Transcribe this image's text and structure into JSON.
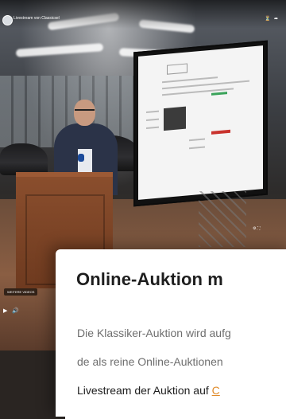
{
  "video": {
    "title": "Livestream von Classicsel",
    "more_videos_label": "WEITERE VIDEOS",
    "icons": [
      "share-icon",
      "watch-later-icon",
      "play-icon",
      "volume-icon",
      "settings-icon",
      "fullscreen-icon"
    ]
  },
  "article": {
    "heading": "Online-Auktion m",
    "line1": "Die Klassiker-Auktion wird aufg",
    "line2": "de als reine Online-Auktionen",
    "line3_prefix": "Livestream der Auktion auf ",
    "line3_link": "C"
  },
  "colors": {
    "link": "#e08b2a",
    "heading": "#1e1e1e",
    "body_text": "#6e6e6e"
  }
}
